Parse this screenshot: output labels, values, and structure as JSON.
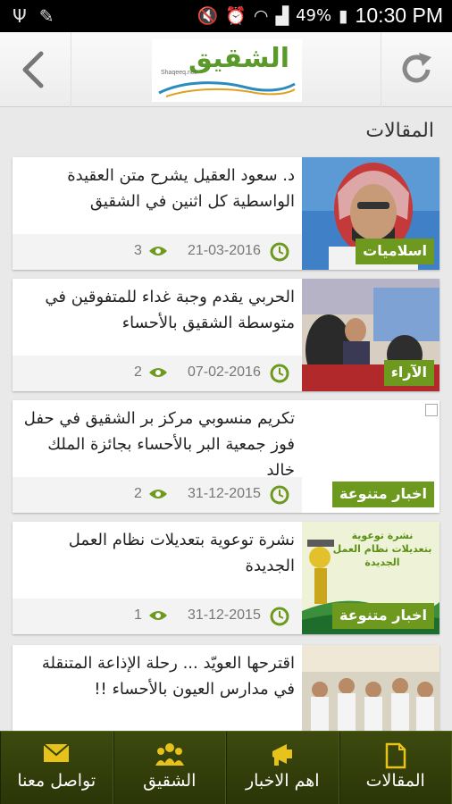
{
  "status_bar": {
    "battery_percent": "49%",
    "time": "10:30 PM"
  },
  "header": {
    "logo_text": "الشقيق",
    "logo_sub": "Shaqeeq.net"
  },
  "section_title": "المقالات",
  "articles": [
    {
      "title": "د. سعود العقيل يشرح متن العقيدة الواسطية كل اثنين في الشقيق",
      "date": "21-03-2016",
      "views": "3",
      "category": "اسلاميات"
    },
    {
      "title": "الحربي يقدم وجبة غداء للمتفوقين في متوسطة الشقيق بالأحساء",
      "date": "07-02-2016",
      "views": "2",
      "category": "الآراء"
    },
    {
      "title": "تكريم منسوبي مركز بر الشقيق في حفل فوز جمعية البر بالأحساء بجائزة الملك خالد",
      "date": "31-12-2015",
      "views": "2",
      "category": "اخبار متنوعة"
    },
    {
      "title": "نشرة توعوية بتعديلات نظام العمل الجديدة",
      "date": "31-12-2015",
      "views": "1",
      "category": "اخبار متنوعة",
      "thumb_text": "نشرة توعوية بتعديلات نظام العمل الجديدة"
    },
    {
      "title": "اقترحها العويّد ... رحلة الإذاعة المتنقلة في مدارس العيون بالأحساء !!",
      "date": "",
      "views": "",
      "category": ""
    }
  ],
  "bottom_nav": [
    {
      "label": "المقالات",
      "icon": "document-icon"
    },
    {
      "label": "اهم الاخبار",
      "icon": "megaphone-icon"
    },
    {
      "label": "الشقيق",
      "icon": "people-icon"
    },
    {
      "label": "تواصل معنا",
      "icon": "envelope-icon"
    }
  ],
  "colors": {
    "accent_green": "#6d9a1e",
    "nav_bg": "#35420c",
    "icon_green": "#7aa51f"
  }
}
